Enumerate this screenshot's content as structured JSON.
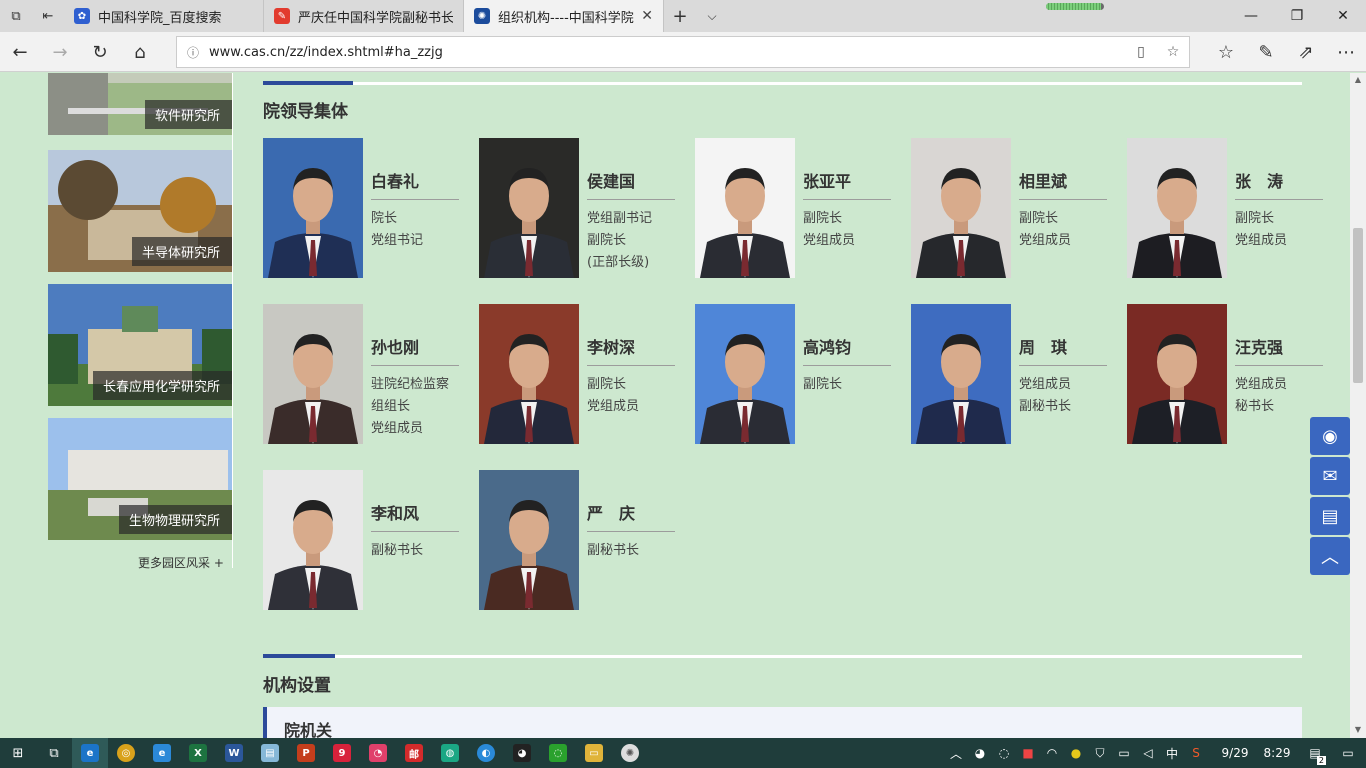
{
  "browser": {
    "tabs": [
      {
        "title": "中国科学院_百度搜索",
        "favicon_color": "#2f5fd0",
        "active": false
      },
      {
        "title": "严庆任中国科学院副秘书长|",
        "favicon_color": "#e23b2e",
        "active": false
      },
      {
        "title": "组织机构----中国科学院",
        "favicon_color": "#1c4c9c",
        "active": true
      }
    ],
    "tab_close_glyph": "✕",
    "new_tab_glyph": "+",
    "url": "www.cas.cn/zz/index.shtml#ha_zzjg",
    "loading_progress": 0.95
  },
  "sidebar": {
    "institutes": [
      {
        "label": "软件研究所",
        "bg_top": "#7a8a74",
        "bg_bottom": "#bfc7b6"
      },
      {
        "label": "半导体研究所",
        "bg_top": "#a7b9cf",
        "bg_bottom": "#7d6a4e"
      },
      {
        "label": "长春应用化学研究所",
        "bg_top": "#4d7cbf",
        "bg_bottom": "#5d7c48"
      },
      {
        "label": "生物物理研究所",
        "bg_top": "#8fb4e6",
        "bg_bottom": "#8c9a6a"
      }
    ],
    "more_link": "更多园区风采 +"
  },
  "leadership": {
    "title": "院领导集体",
    "people": [
      {
        "name": "白春礼",
        "roles": [
          "院长",
          "党组书记"
        ],
        "bg": "#3a6ab0",
        "suit": "#1f2f55"
      },
      {
        "name": "侯建国",
        "roles": [
          "党组副书记",
          "副院长",
          "(正部长级)"
        ],
        "bg": "#2a2a28",
        "suit": "#2a2e36"
      },
      {
        "name": "张亚平",
        "roles": [
          "副院长",
          "党组成员"
        ],
        "bg": "#f4f4f4",
        "suit": "#2a2c33"
      },
      {
        "name": "相里斌",
        "roles": [
          "副院长",
          "党组成员"
        ],
        "bg": "#d9d6d3",
        "suit": "#26282c"
      },
      {
        "name": "张　涛",
        "roles": [
          "副院长",
          "党组成员"
        ],
        "bg": "#dcdcdc",
        "suit": "#1d1d22"
      },
      {
        "name": "孙也刚",
        "roles": [
          "驻院纪检监察",
          "组组长",
          "党组成员"
        ],
        "bg": "#c8c8c2",
        "suit": "#3a2c2a"
      },
      {
        "name": "李树深",
        "roles": [
          "副院长",
          "党组成员"
        ],
        "bg": "#8a3a2a",
        "suit": "#23283a"
      },
      {
        "name": "高鸿钧",
        "roles": [
          "副院长"
        ],
        "bg": "#4f86d8",
        "suit": "#2a2c34"
      },
      {
        "name": "周　琪",
        "roles": [
          "党组成员",
          "副秘书长"
        ],
        "bg": "#3e6cc0",
        "suit": "#1f2a4c"
      },
      {
        "name": "汪克强",
        "roles": [
          "党组成员",
          "秘书长"
        ],
        "bg": "#7a2a24",
        "suit": "#1d1f26"
      },
      {
        "name": "李和风",
        "roles": [
          "副秘书长"
        ],
        "bg": "#e8e8e8",
        "suit": "#2f3038"
      },
      {
        "name": "严　庆",
        "roles": [
          "副秘书长"
        ],
        "bg": "#4a6a8a",
        "suit": "#4a2a22"
      }
    ]
  },
  "organization": {
    "title": "机构设置",
    "first_group": "院机关"
  },
  "float_buttons": [
    "weibo-icon",
    "wechat-icon",
    "message-icon",
    "back-to-top-icon"
  ],
  "taskbar": {
    "time": "8:29",
    "date": "9/29",
    "ime": "中",
    "notification_count": "2"
  },
  "colors": {
    "page_bg": "#cde8cf",
    "accent": "#2c4a9a",
    "float_button": "#3a67c0",
    "taskbar": "#1f3d3b"
  }
}
